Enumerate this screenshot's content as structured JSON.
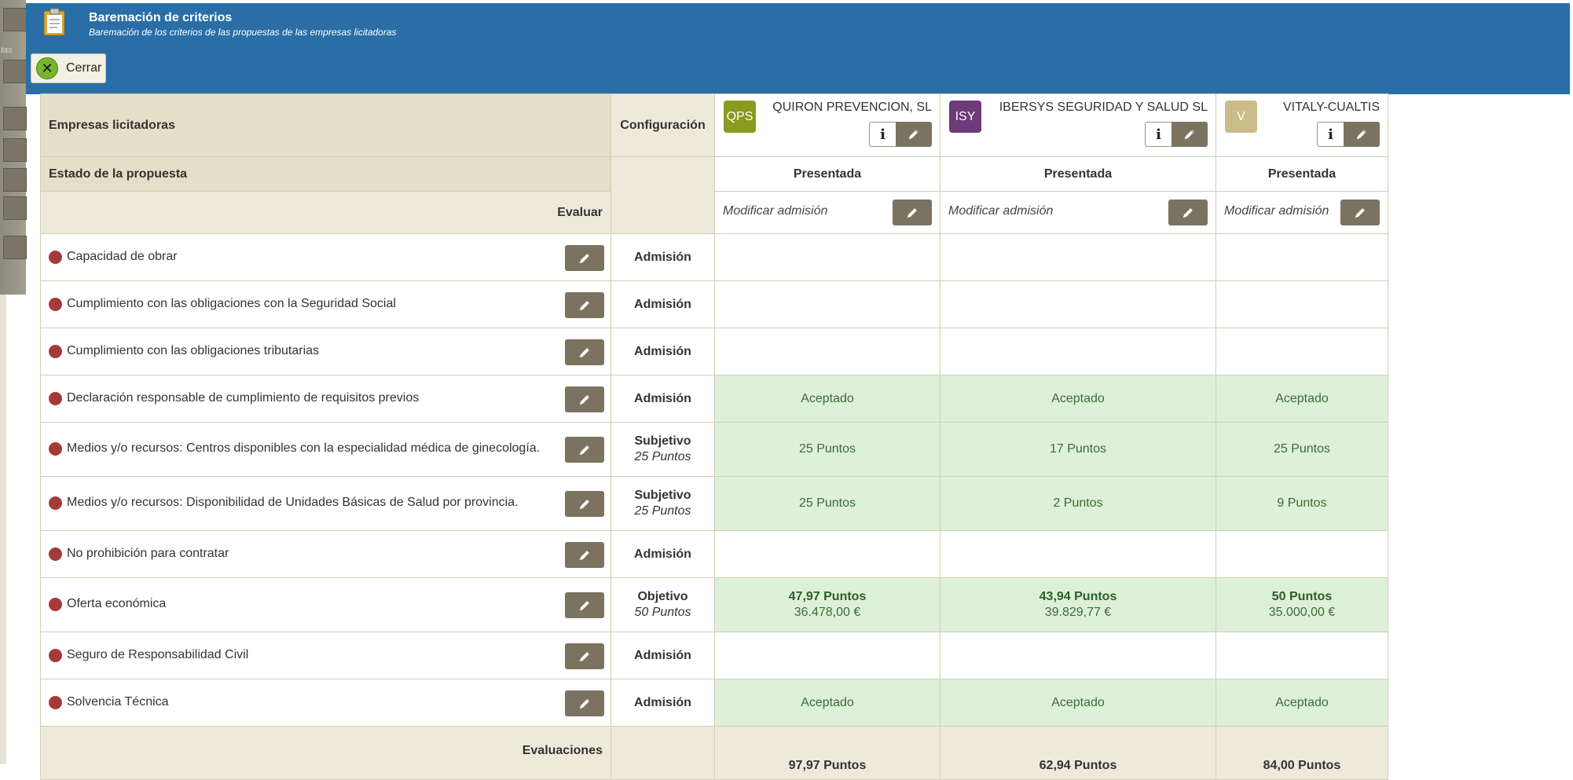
{
  "header": {
    "title": "Baremación de criterios",
    "subtitle": "Baremación de los criterios de las propuestas de las empresas licitadoras",
    "close_label": "Cerrar",
    "background_color": "#2a6ea8",
    "left_strip_text": "tas"
  },
  "table": {
    "empresas_label": "Empresas licitadoras",
    "configuracion_label": "Configuración",
    "estado_label": "Estado de la propuesta",
    "evaluar_label": "Evaluar",
    "modificar_label": "Modificar admisión",
    "evaluaciones_label": "Evaluaciones",
    "companies": [
      {
        "initials": "QPS",
        "name": "QUIRON PREVENCION, SL",
        "color": "#8a9a1e",
        "estado": "Presentada",
        "total": "97,97 Puntos"
      },
      {
        "initials": "ISY",
        "name": "IBERSYS SEGURIDAD Y SALUD SL",
        "color": "#6e3a7a",
        "estado": "Presentada",
        "total": "62,94 Puntos"
      },
      {
        "initials": "V",
        "name": "VITALY-CUALTIS",
        "color": "#cbbd8a",
        "estado": "Presentada",
        "total": "84,00 Puntos"
      }
    ],
    "criteria": [
      {
        "name": "Capacidad de obrar",
        "type": "Admisión",
        "points": "",
        "values": [
          "",
          "",
          ""
        ]
      },
      {
        "name": "Cumplimiento con las obligaciones con la Seguridad Social",
        "type": "Admisión",
        "points": "",
        "values": [
          "",
          "",
          ""
        ]
      },
      {
        "name": "Cumplimiento con las obligaciones tributarias",
        "type": "Admisión",
        "points": "",
        "values": [
          "",
          "",
          ""
        ]
      },
      {
        "name": "Declaración responsable de cumplimiento de requisitos previos",
        "type": "Admisión",
        "points": "",
        "values": [
          "Aceptado",
          "Aceptado",
          "Aceptado"
        ]
      },
      {
        "name": "Medios y/o recursos: Centros disponibles con la especialidad médica de ginecología.",
        "type": "Subjetivo",
        "points": "25 Puntos",
        "values": [
          "25 Puntos",
          "17 Puntos",
          "25 Puntos"
        ]
      },
      {
        "name": "Medios y/o recursos: Disponibilidad de Unidades Básicas de Salud por provincia.",
        "type": "Subjetivo",
        "points": "25 Puntos",
        "values": [
          "25 Puntos",
          "2 Puntos",
          "9 Puntos"
        ]
      },
      {
        "name": "No prohibición para contratar",
        "type": "Admisión",
        "points": "",
        "values": [
          "",
          "",
          ""
        ]
      },
      {
        "name": "Oferta económica",
        "type": "Objetivo",
        "points": "50 Puntos",
        "values": [
          "47,97 Puntos",
          "43,94 Puntos",
          "50 Puntos"
        ],
        "amounts": [
          "36.478,00 €",
          "39.829,77 €",
          "35.000,00 €"
        ]
      },
      {
        "name": "Seguro de Responsabilidad Civil",
        "type": "Admisión",
        "points": "",
        "values": [
          "",
          "",
          ""
        ]
      },
      {
        "name": "Solvencia Técnica",
        "type": "Admisión",
        "points": "",
        "values": [
          "Aceptado",
          "Aceptado",
          "Aceptado"
        ]
      }
    ]
  }
}
